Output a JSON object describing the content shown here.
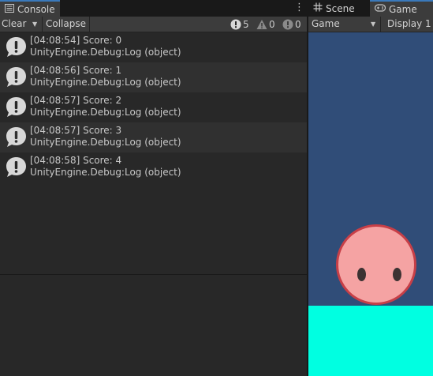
{
  "console": {
    "tab_label": "Console",
    "toolbar": {
      "clear_label": "Clear",
      "collapse_label": "Collapse",
      "log_count": "5",
      "warning_count": "0",
      "error_count": "0"
    },
    "logs": [
      {
        "message": "[04:08:54] Score: 0",
        "trace": "UnityEngine.Debug:Log (object)"
      },
      {
        "message": "[04:08:56] Score: 1",
        "trace": "UnityEngine.Debug:Log (object)"
      },
      {
        "message": "[04:08:57] Score: 2",
        "trace": "UnityEngine.Debug:Log (object)"
      },
      {
        "message": "[04:08:57] Score: 3",
        "trace": "UnityEngine.Debug:Log (object)"
      },
      {
        "message": "[04:08:58] Score: 4",
        "trace": "UnityEngine.Debug:Log (object)"
      }
    ]
  },
  "game_panel": {
    "scene_tab_label": "Scene",
    "game_tab_label": "Game",
    "view_select": "Game",
    "display_select": "Display 1"
  },
  "colors": {
    "sky": "#304d78",
    "ground": "#00ffe1",
    "ball_fill": "#f5a3a3",
    "ball_outline": "#c73f47",
    "tab_accent": "#3a79bb"
  }
}
